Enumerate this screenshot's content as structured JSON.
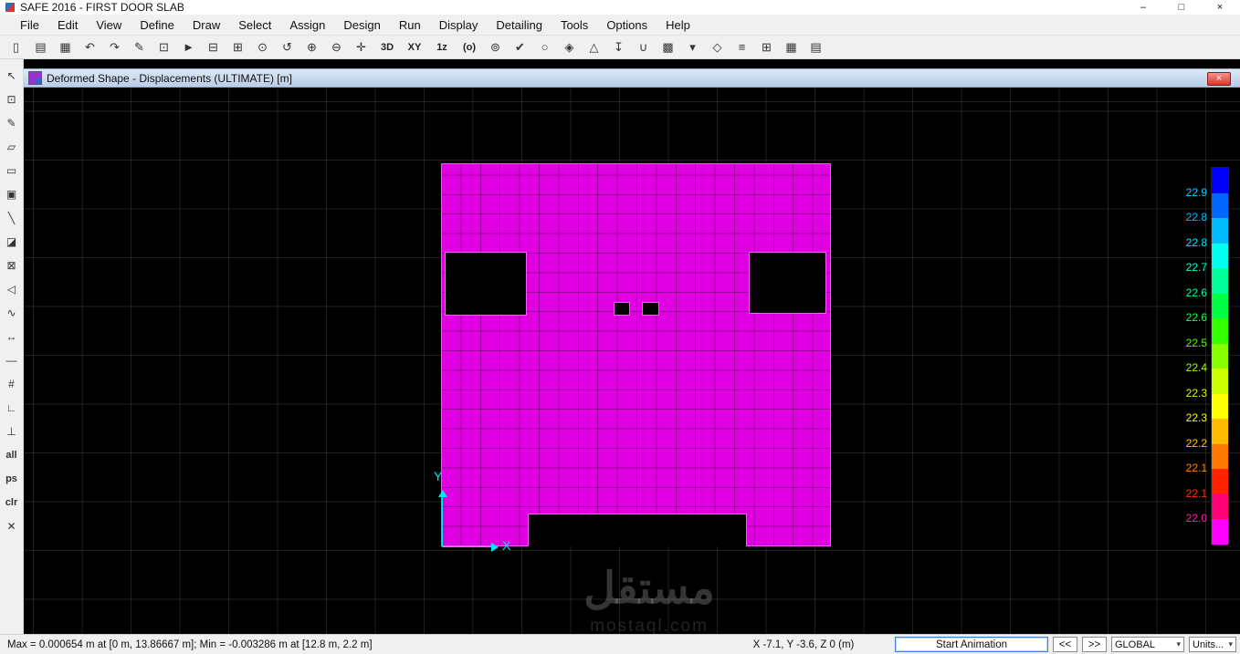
{
  "app": {
    "title": "SAFE 2016 - FIRST DOOR SLAB",
    "window_controls": [
      {
        "name": "minimize",
        "glyph": "–"
      },
      {
        "name": "maximize",
        "glyph": "□"
      },
      {
        "name": "close",
        "glyph": "×"
      }
    ]
  },
  "menu": {
    "items": [
      "File",
      "Edit",
      "View",
      "Define",
      "Draw",
      "Select",
      "Assign",
      "Design",
      "Run",
      "Display",
      "Detailing",
      "Tools",
      "Options",
      "Help"
    ]
  },
  "toolbar": {
    "buttons": [
      {
        "name": "new-model",
        "glyph": "▯"
      },
      {
        "name": "open-file",
        "glyph": "▤"
      },
      {
        "name": "save",
        "glyph": "▦"
      },
      {
        "name": "undo",
        "glyph": "↶"
      },
      {
        "name": "redo",
        "glyph": "↷"
      },
      {
        "name": "edit-pen",
        "glyph": "✎"
      },
      {
        "name": "lock-model",
        "glyph": "⊡"
      },
      {
        "name": "run-analysis",
        "glyph": "►"
      },
      {
        "name": "model-explorer",
        "glyph": "⊟"
      },
      {
        "name": "rubber-band-zoom",
        "glyph": "⊞"
      },
      {
        "name": "restore-full-view",
        "glyph": "⊙"
      },
      {
        "name": "previous-zoom",
        "glyph": "↺"
      },
      {
        "name": "zoom-in",
        "glyph": "⊕"
      },
      {
        "name": "zoom-out",
        "glyph": "⊖"
      },
      {
        "name": "pan",
        "glyph": "✛"
      },
      {
        "name": "view-3d",
        "glyph": "3D",
        "text": true
      },
      {
        "name": "view-plan",
        "glyph": "XY",
        "text": true
      },
      {
        "name": "view-elevation",
        "glyph": "1z",
        "text": true
      },
      {
        "name": "rotate-3d-view",
        "glyph": "(o)",
        "text": true
      },
      {
        "name": "object-visibility",
        "glyph": "⊚"
      },
      {
        "name": "set-display-options",
        "glyph": "✔"
      },
      {
        "name": "draw-circle",
        "glyph": "○"
      },
      {
        "name": "assign-load",
        "glyph": "◈"
      },
      {
        "name": "draw-area",
        "glyph": "△"
      },
      {
        "name": "insert-support",
        "glyph": "↧"
      },
      {
        "name": "strip-display",
        "glyph": "∪"
      },
      {
        "name": "capture-image",
        "glyph": "▩"
      },
      {
        "name": "display-menu",
        "glyph": "▾"
      },
      {
        "name": "detailing-tool",
        "glyph": "◇"
      },
      {
        "name": "crack-widths",
        "glyph": "≡"
      },
      {
        "name": "show-grid",
        "glyph": "⊞"
      },
      {
        "name": "show-tables",
        "glyph": "▦"
      },
      {
        "name": "report-tables",
        "glyph": "▤"
      }
    ]
  },
  "left_toolbar": {
    "buttons": [
      {
        "name": "select-pointer",
        "glyph": "↖"
      },
      {
        "name": "select-poly",
        "glyph": "⊡"
      },
      {
        "name": "draw-pen",
        "glyph": "✎"
      },
      {
        "name": "draw-slab",
        "glyph": "▱"
      },
      {
        "name": "draw-rect-slab",
        "glyph": "▭"
      },
      {
        "name": "quick-draw-slab",
        "glyph": "▣"
      },
      {
        "name": "draw-line",
        "glyph": "╲"
      },
      {
        "name": "draw-wall",
        "glyph": "◪"
      },
      {
        "name": "draw-opening",
        "glyph": "⊠"
      },
      {
        "name": "draw-column",
        "glyph": "◁"
      },
      {
        "name": "draw-tendon",
        "glyph": "∿"
      },
      {
        "name": "draw-dimension",
        "glyph": "↔"
      },
      {
        "name": "draw-design-strip",
        "glyph": "—"
      },
      {
        "name": "edit-grid",
        "glyph": "#"
      },
      {
        "name": "measure",
        "glyph": "∟"
      },
      {
        "name": "snap-points",
        "glyph": "⊥"
      },
      {
        "name": "select-all",
        "glyph": "all",
        "text": true
      },
      {
        "name": "previous-selection",
        "glyph": "ps",
        "text": true
      },
      {
        "name": "clear-selection",
        "glyph": "clr",
        "text": true
      },
      {
        "name": "snap-intersections",
        "glyph": "✕"
      }
    ]
  },
  "document_window": {
    "title": "Deformed Shape - Displacements (ULTIMATE)  [m]",
    "close_glyph": "×"
  },
  "legend": {
    "strip_colors": [
      "#0000FF",
      "#0066FF",
      "#00BBFF",
      "#00FFEE",
      "#00FF99",
      "#00FF44",
      "#33FF00",
      "#88FF00",
      "#CCFF00",
      "#FFFF00",
      "#FFBB00",
      "#FF7700",
      "#FF2200",
      "#FF0077",
      "#FF00FF"
    ],
    "labels": [
      {
        "text": "22.9",
        "color": "#00CFFF"
      },
      {
        "text": "22.8",
        "color": "#00BFFF"
      },
      {
        "text": "22.8",
        "color": "#00E8FF"
      },
      {
        "text": "22.7",
        "color": "#00FFD5"
      },
      {
        "text": "22.6",
        "color": "#00FF99"
      },
      {
        "text": "22.6",
        "color": "#22FF44"
      },
      {
        "text": "22.5",
        "color": "#55FF00"
      },
      {
        "text": "22.4",
        "color": "#99FF00"
      },
      {
        "text": "22.3",
        "color": "#CCFF00"
      },
      {
        "text": "22.3",
        "color": "#EEFF00"
      },
      {
        "text": "22.2",
        "color": "#FFCC00"
      },
      {
        "text": "22.1",
        "color": "#FF8800"
      },
      {
        "text": "22.1",
        "color": "#FF3300"
      },
      {
        "text": "22.0",
        "color": "#FF22AA"
      }
    ]
  },
  "axes": {
    "x_label": "X",
    "y_label": "Y"
  },
  "watermark": {
    "title": "مستقل",
    "subtitle": "mostaql.com"
  },
  "statusbar": {
    "left_text": "Max = 0.000654 m at [0 m, 13.86667 m];  Min = -0.003286 m at [12.8 m, 2.2 m]",
    "coords": "X -7.1,  Y -3.6,  Z 0  (m)",
    "start_animation": "Start Animation",
    "prev": "<<",
    "next": ">>",
    "csys": "GLOBAL",
    "units": "Units...",
    "caret": "▾"
  },
  "colors": {
    "contour_fill": "#E100E1",
    "viewport_bg": "#000000",
    "axis_color": "#00E5FF"
  }
}
